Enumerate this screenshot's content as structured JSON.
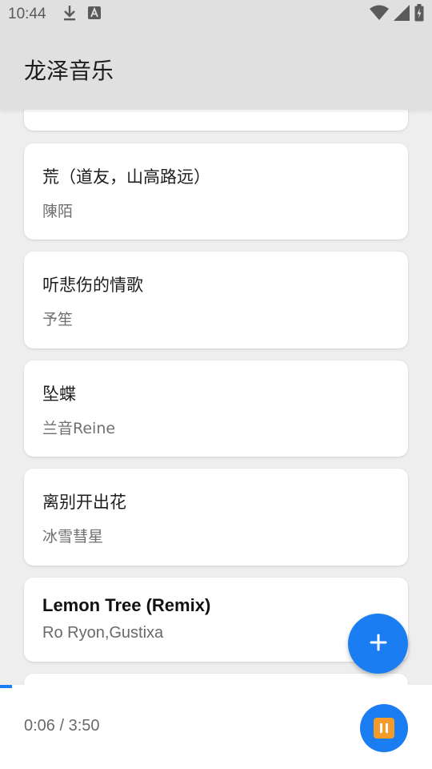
{
  "status_bar": {
    "time": "10:44",
    "left_icons": [
      "download-icon",
      "text-a-icon"
    ],
    "right_icons": [
      "wifi-icon",
      "signal-icon",
      "battery-icon"
    ]
  },
  "app_bar": {
    "title": "龙泽音乐"
  },
  "songs": [
    {
      "title": "",
      "artist": ""
    },
    {
      "title": "荒（道友，山高路远）",
      "artist": "陳陌"
    },
    {
      "title": "听悲伤的情歌",
      "artist": "予笙"
    },
    {
      "title": "坠蝶",
      "artist": "兰音Reine"
    },
    {
      "title": "离别开出花",
      "artist": "冰雪彗星"
    },
    {
      "title": "Lemon Tree (Remix)",
      "artist": "Ro Ryon,Gustixa",
      "playing": true
    },
    {
      "title": "",
      "artist": ""
    }
  ],
  "fab": {
    "icon": "plus-icon",
    "label": "+"
  },
  "player": {
    "time_display": "0:06 / 3:50",
    "progress": 0.027,
    "pause_icon": "pause-icon"
  },
  "colors": {
    "accent": "#1a7ef2",
    "pause_badge": "#f39c2b",
    "app_bar_bg": "#e0e0e0",
    "list_bg": "#eeeeee"
  }
}
